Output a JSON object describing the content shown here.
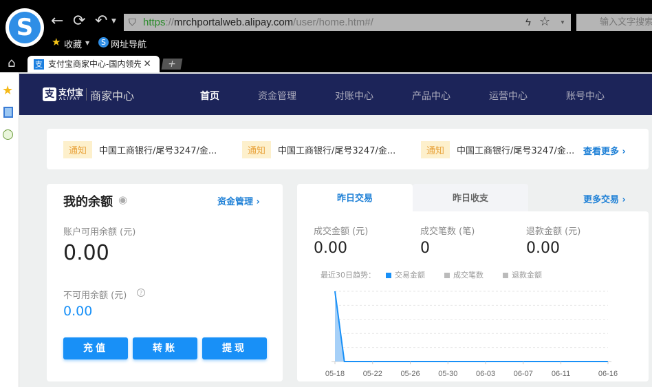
{
  "browser": {
    "url_scheme": "https",
    "url_sep": "://",
    "url_host": "mrchportalweb.alipay.com",
    "url_path": "/user/home.htm#/",
    "search_placeholder": "输入文字搜索",
    "bookmarks": [
      "收藏",
      "网址导航"
    ],
    "tab_title": "支付宝商家中心-国内领先"
  },
  "header": {
    "brand": "支付宝",
    "brand_en": "ALIPAY",
    "product": "商家中心",
    "nav": [
      "首页",
      "资金管理",
      "对账中心",
      "产品中心",
      "运营中心",
      "账号中心"
    ],
    "active": 0
  },
  "notices": {
    "tag": "通知",
    "items": [
      "中国工商银行/尾号3247/金...",
      "中国工商银行/尾号3247/金...",
      "中国工商银行/尾号3247/金..."
    ],
    "more": "查看更多"
  },
  "balance": {
    "title": "我的余额",
    "link": "资金管理",
    "available_label": "账户可用余额 (元)",
    "available": "0.00",
    "unavailable_label": "不可用余额 (元)",
    "unavailable": "0.00",
    "buttons": [
      "充值",
      "转账",
      "提现"
    ]
  },
  "trade": {
    "tabs": [
      "昨日交易",
      "昨日收支"
    ],
    "more": "更多交易",
    "stats": [
      {
        "label": "成交金额 (元)",
        "value": "0.00"
      },
      {
        "label": "成交笔数 (笔)",
        "value": "0"
      },
      {
        "label": "退款金额 (元)",
        "value": "0.00"
      }
    ],
    "trend_label": "最近30日趋势："
  },
  "colors": {
    "accent": "#1890f7",
    "nav_bg": "#1c2459"
  },
  "chart_data": {
    "type": "area",
    "title": "最近30日趋势",
    "legend": [
      {
        "name": "交易金额",
        "color": "#1890f7"
      },
      {
        "name": "成交笔数",
        "color": "#bbbbbb"
      },
      {
        "name": "退款金额",
        "color": "#bbbbbb"
      }
    ],
    "x_ticks": [
      "05-18",
      "05-22",
      "05-26",
      "05-30",
      "06-03",
      "06-07",
      "06-11",
      "06-16"
    ],
    "series": [
      {
        "name": "交易金额",
        "values": [
          1,
          0,
          0,
          0,
          0,
          0,
          0,
          0,
          0,
          0,
          0,
          0,
          0,
          0,
          0,
          0,
          0,
          0,
          0,
          0,
          0,
          0,
          0,
          0,
          0,
          0,
          0,
          0,
          0,
          0
        ]
      }
    ],
    "ylim": [
      0,
      1
    ],
    "grid": true,
    "legend_position": "top-left"
  }
}
